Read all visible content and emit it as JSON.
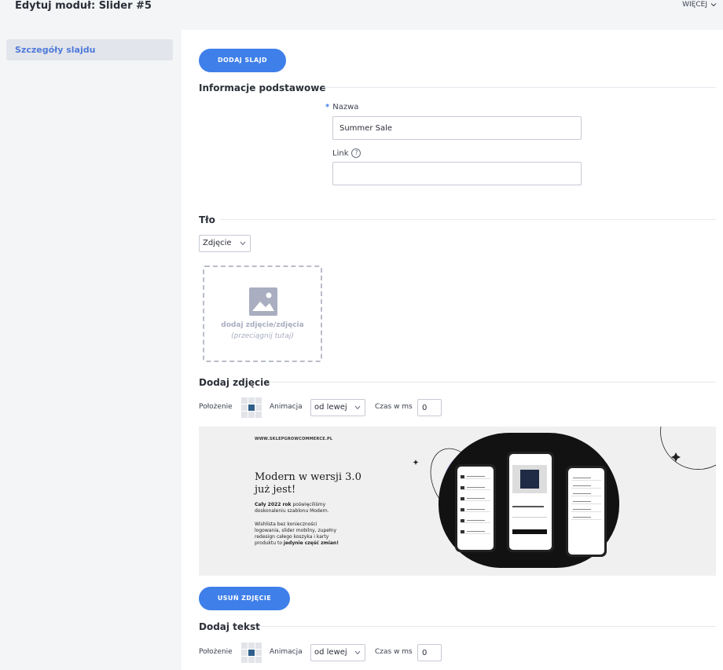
{
  "header": {
    "title": "Edytuj moduł: Slider #5",
    "more_label": "WIĘCEJ"
  },
  "sidebar": {
    "items": [
      {
        "label": "Szczegóły slajdu"
      }
    ]
  },
  "buttons": {
    "add_slide": "DODAJ SLAJD",
    "remove_image": "USUŃ ZDJĘCIE"
  },
  "basic_info": {
    "title": "Informacje podstawowe",
    "name_required_mark": "*",
    "name_label": "Nazwa",
    "name_value": "Summer Sale",
    "link_label": "Link",
    "link_help": "?",
    "link_value": ""
  },
  "background": {
    "title": "Tło",
    "type_select": "Zdjęcie",
    "dropzone_main": "dodaj zdjęcie/zdjęcia",
    "dropzone_sub": "(przeciągnij tutaj)"
  },
  "add_image": {
    "title": "Dodaj zdjęcie",
    "position_label": "Położenie",
    "animation_label": "Animacja",
    "animation_value": "od lewej",
    "time_label": "Czas w ms",
    "time_value": "0"
  },
  "banner": {
    "site": "WWW.SKLEPGROWCOMMERCE.PL",
    "headline_line1": "Modern w wersji 3.0",
    "headline_line2": "już jest!",
    "para1_bold": "Cały 2022 rok",
    "para1_rest": " poświęciliśmy doskonaleniu szablonu Modern.",
    "para2": "Wishlista bez konieczności logowania, slider mobilny, zupełny redesign całego koszyka i karty produktu to",
    "para2_bold": "jedynie część zmian!"
  },
  "add_text": {
    "title": "Dodaj tekst",
    "position_label": "Położenie",
    "animation_label": "Animacja",
    "animation_value": "od lewej",
    "time_label": "Czas w ms",
    "time_value": "0"
  },
  "colors": {
    "accent": "#3f7fe9",
    "sidebar_active_bg": "#e3e5ec",
    "position_active": "#2f5f8a"
  }
}
